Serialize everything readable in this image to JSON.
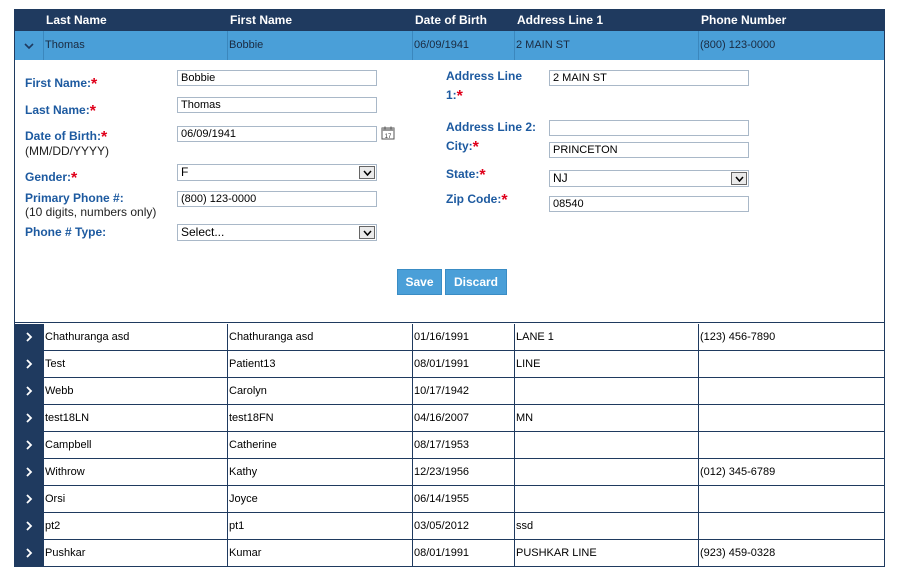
{
  "header": {
    "columns": [
      "Last Name",
      "First Name",
      "Date of Birth",
      "Address Line 1",
      "Phone Number"
    ]
  },
  "selected": {
    "last_name": "Thomas",
    "first_name": "Bobbie",
    "dob": "06/09/1941",
    "address1": "2 MAIN ST",
    "phone": "(800) 123-0000"
  },
  "form": {
    "first_name_label": "First Name:",
    "last_name_label": "Last Name:",
    "dob_label": "Date of Birth:",
    "dob_format": "(MM/DD/YYYY)",
    "gender_label": "Gender:",
    "phone_label": "Primary Phone #:",
    "phone_hint": "(10 digits, numbers only)",
    "phone_type_label": "Phone # Type:",
    "address1_label_a": "Address Line",
    "address1_label_b": "1:",
    "address2_label": "Address Line 2:",
    "city_label": "City:",
    "state_label": "State:",
    "zip_label": "Zip Code:",
    "required_mark": "*",
    "first_name_value": "Bobbie",
    "last_name_value": "Thomas",
    "dob_value": "06/09/1941",
    "gender_value": "F",
    "phone_value": "(800) 123-0000",
    "phone_type_value": "Select...",
    "address1_value": "2 MAIN ST",
    "address2_value": "",
    "city_value": "PRINCETON",
    "state_value": "NJ",
    "zip_value": "08540",
    "save_label": "Save",
    "discard_label": "Discard"
  },
  "rows": [
    {
      "last": "Chathuranga asd",
      "first": "Chathuranga asd",
      "dob": "01/16/1991",
      "addr": "LANE 1",
      "phone": "(123) 456-7890"
    },
    {
      "last": "Test",
      "first": "Patient13",
      "dob": "08/01/1991",
      "addr": "LINE",
      "phone": ""
    },
    {
      "last": "Webb",
      "first": "Carolyn",
      "dob": "10/17/1942",
      "addr": "",
      "phone": ""
    },
    {
      "last": "test18LN",
      "first": "test18FN",
      "dob": "04/16/2007",
      "addr": "MN",
      "phone": ""
    },
    {
      "last": "Campbell",
      "first": "Catherine",
      "dob": "08/17/1953",
      "addr": "",
      "phone": ""
    },
    {
      "last": "Withrow",
      "first": "Kathy",
      "dob": "12/23/1956",
      "addr": "",
      "phone": "(012) 345-6789"
    },
    {
      "last": "Orsi",
      "first": "Joyce",
      "dob": "06/14/1955",
      "addr": "",
      "phone": ""
    },
    {
      "last": "pt2",
      "first": "pt1",
      "dob": "03/05/2012",
      "addr": "ssd",
      "phone": ""
    },
    {
      "last": "Pushkar",
      "first": "Kumar",
      "dob": "08/01/1991",
      "addr": "PUSHKAR LINE",
      "phone": "(923) 459-0328"
    }
  ],
  "colors": {
    "header_bg": "#1f3a5f",
    "selected_bg": "#4a9fd8",
    "label": "#1d5aa0",
    "required": "#e0001b"
  },
  "icons": {
    "expand": "chevron-right-icon",
    "collapse": "chevron-down-icon",
    "calendar": "calendar-icon",
    "dropdown": "dropdown-arrow-icon"
  }
}
